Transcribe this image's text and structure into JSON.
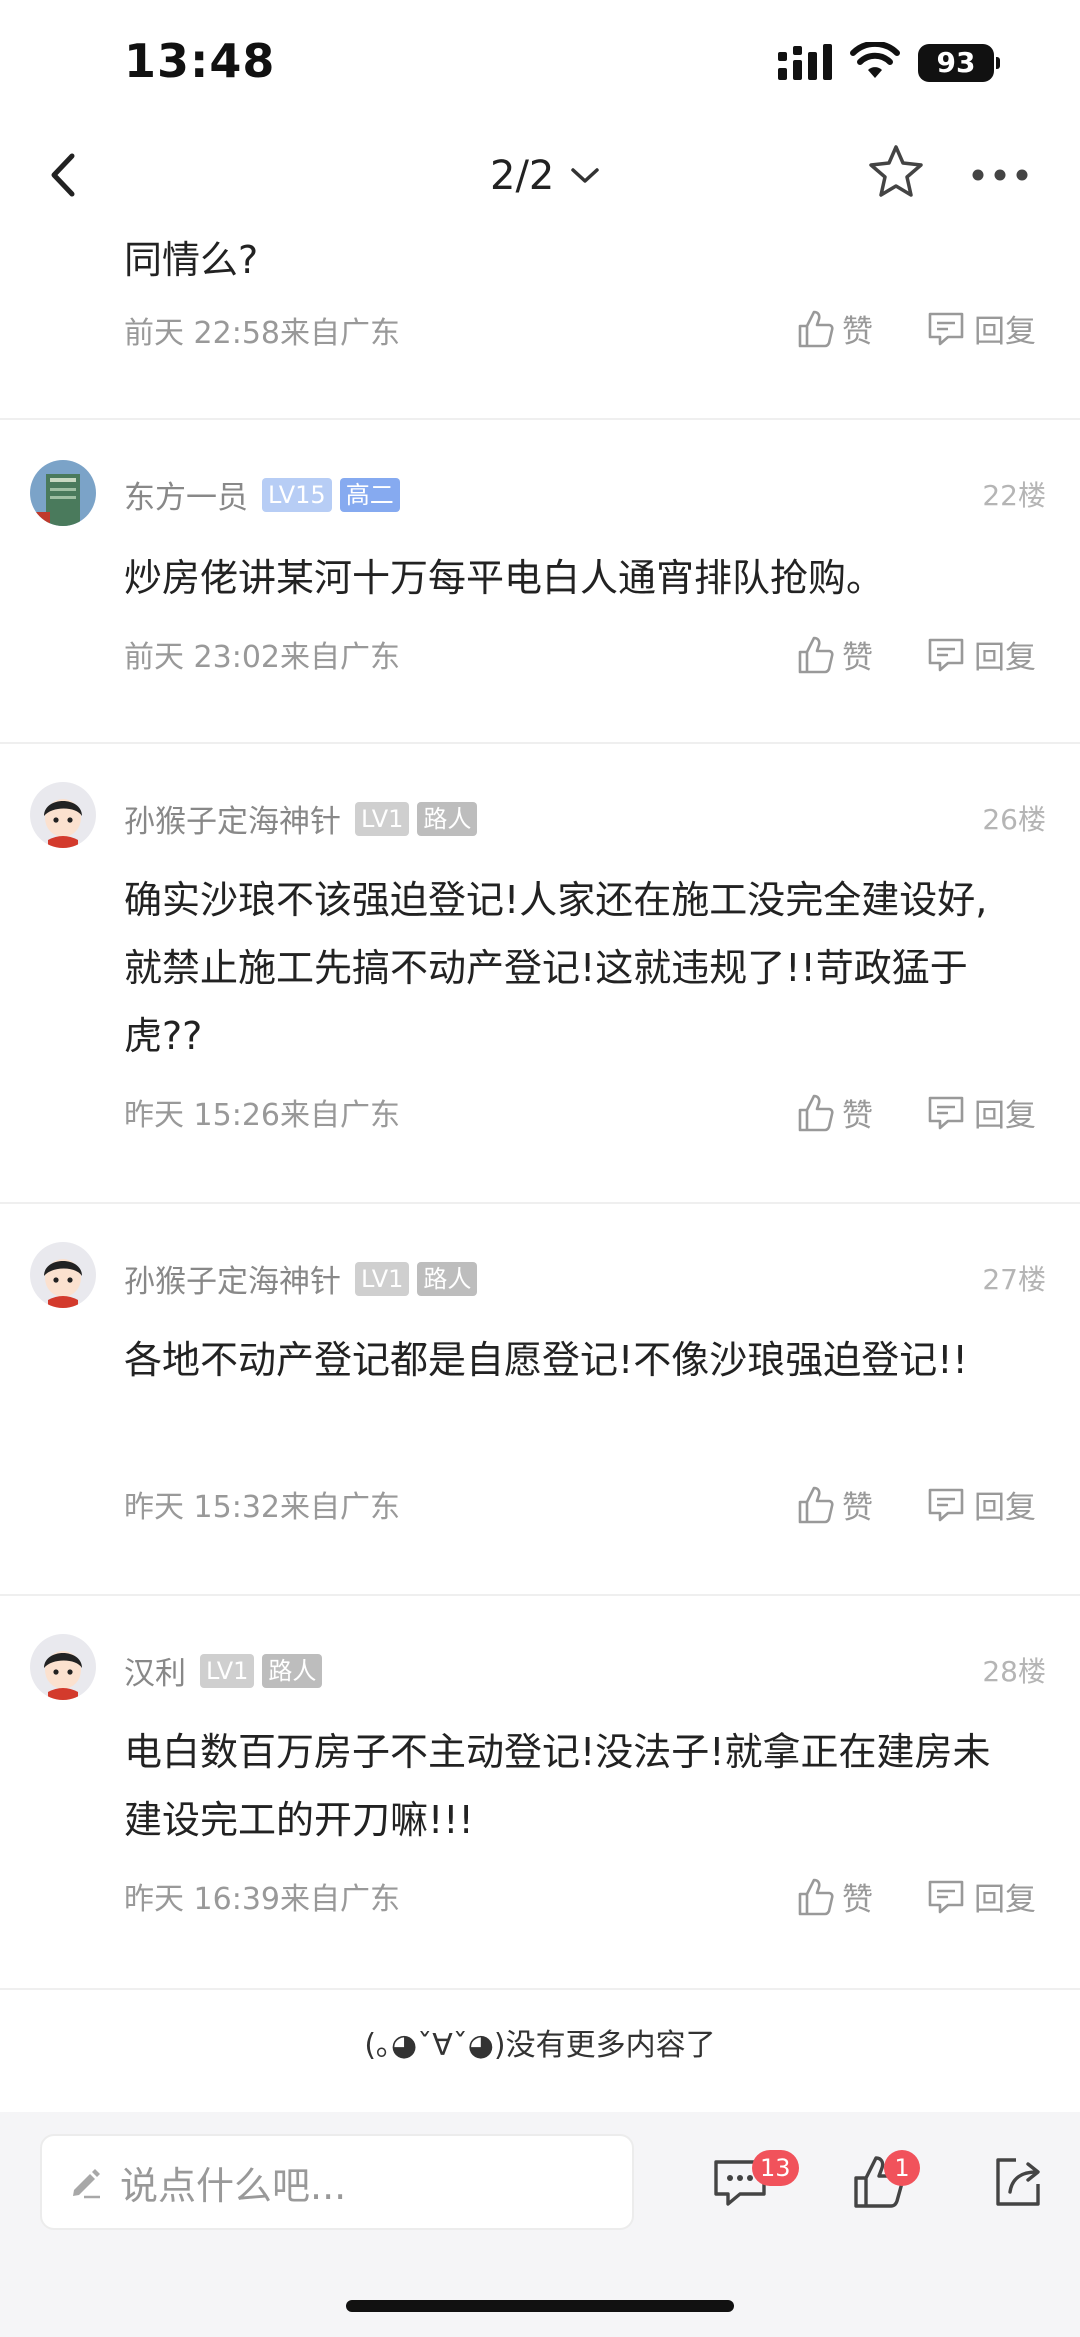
{
  "status_bar": {
    "time": "13:48",
    "battery": "93"
  },
  "nav": {
    "page_indicator": "2/2"
  },
  "posts": [
    {
      "content": "同情么?",
      "time": "前天 22:58来自广东",
      "like_label": "赞",
      "reply_label": "回复"
    },
    {
      "username": "东方一员",
      "level": "LV15",
      "tag": "高二",
      "floor": "22楼",
      "content": "炒房佬讲某河十万每平电白人通宵排队抢购。",
      "time": "前天 23:02来自广东",
      "like_label": "赞",
      "reply_label": "回复"
    },
    {
      "username": "孙猴子定海神针",
      "level": "LV1",
      "tag": "路人",
      "floor": "26楼",
      "content": "确实沙琅不该强迫登记!人家还在施工没完全建设好,就禁止施工先搞不动产登记!这就违规了!!苛政猛于虎??",
      "time": "昨天 15:26来自广东",
      "like_label": "赞",
      "reply_label": "回复"
    },
    {
      "username": "孙猴子定海神针",
      "level": "LV1",
      "tag": "路人",
      "floor": "27楼",
      "content": "各地不动产登记都是自愿登记!不像沙琅强迫登记!!",
      "time": "昨天 15:32来自广东",
      "like_label": "赞",
      "reply_label": "回复"
    },
    {
      "username": "汉利",
      "level": "LV1",
      "tag": "路人",
      "floor": "28楼",
      "content": "电白数百万房子不主动登记!没法子!就拿正在建房未建设完工的开刀嘛!!!",
      "time": "昨天 16:39来自广东",
      "like_label": "赞",
      "reply_label": "回复"
    }
  ],
  "no_more_text": "(｡◕ˇ∀ˇ◕)没有更多内容了",
  "bottom_bar": {
    "input_placeholder": "说点什么吧...",
    "comment_count": "13",
    "like_count": "1"
  },
  "colors": {
    "badge_red": "#f1525b",
    "level_blue": "#b7cdf5",
    "tag_blue": "#86aaf0",
    "level_gray": "#cfcfcf"
  }
}
